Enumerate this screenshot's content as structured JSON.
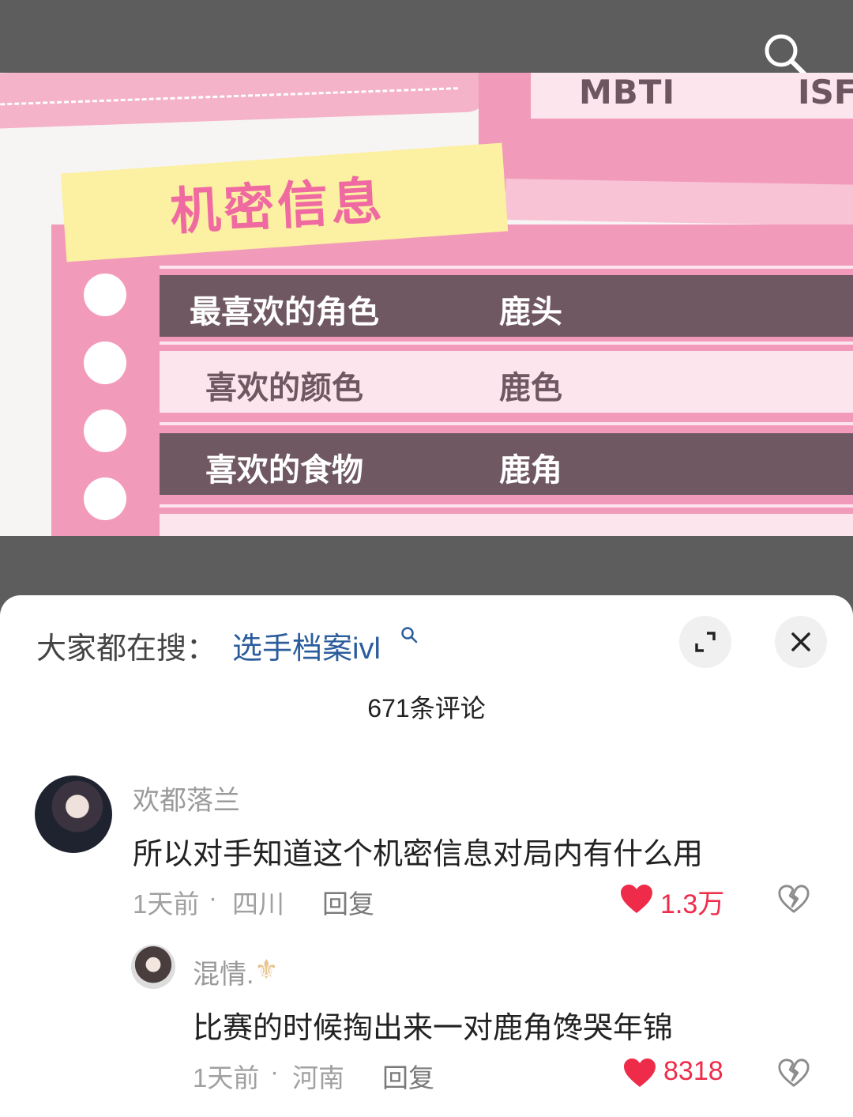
{
  "video": {
    "mbti_label": "MBTI",
    "mbti_value": "ISF",
    "section_title": "机密信息",
    "rows": [
      {
        "key": "最喜欢的角色",
        "value": "鹿头"
      },
      {
        "key": "喜欢的颜色",
        "value": "鹿色"
      },
      {
        "key": "喜欢的食物",
        "value": "鹿角"
      }
    ]
  },
  "sheet": {
    "trending_prefix": "大家都在搜：",
    "trending_query": "选手档案ivl",
    "comment_count": "671条评论",
    "comments": [
      {
        "username": "欢都落兰",
        "text": "所以对手知道这个机密信息对局内有什么用",
        "time": "1天前",
        "location": "四川",
        "reply_label": "回复",
        "likes": "1.3万"
      },
      {
        "username": "混情.",
        "text": "比赛的时候掏出来一对鹿角馋哭年锦",
        "time": "1天前",
        "location": "河南",
        "reply_label": "回复",
        "likes": "8318"
      }
    ]
  },
  "colors": {
    "pink": "#f29ab9",
    "dark_row": "#705862",
    "link_blue": "#2b5d9c",
    "like_red": "#ee2c4a"
  },
  "icons": [
    "search-icon",
    "expand-icon",
    "close-icon",
    "heart-icon",
    "broken-heart-icon",
    "fleur-de-lis-icon"
  ]
}
